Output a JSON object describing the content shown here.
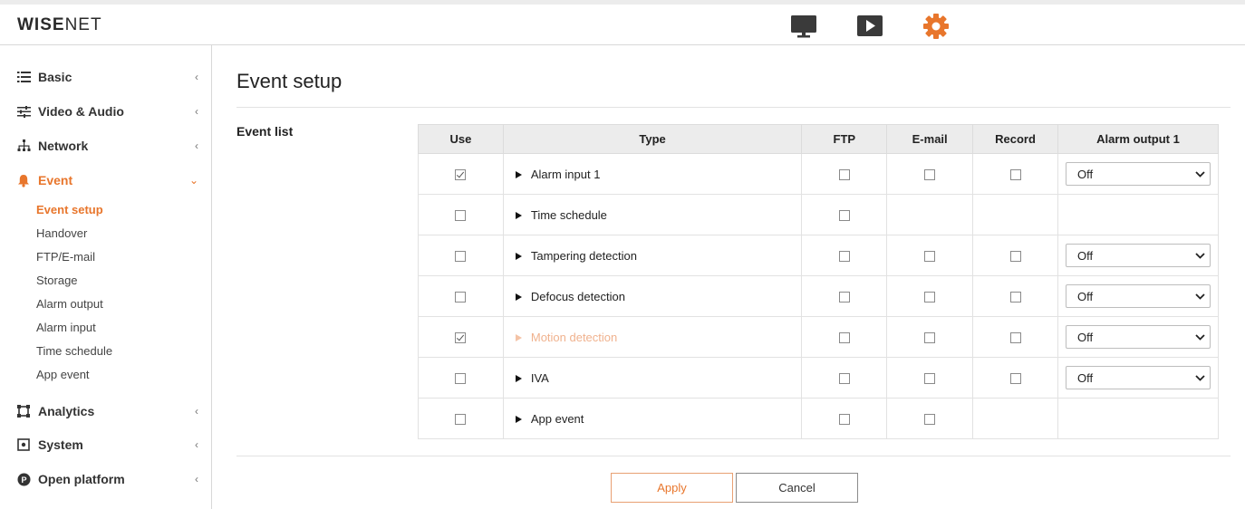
{
  "brand": {
    "logo_bold": "WISE",
    "logo_light": "NET"
  },
  "header": {
    "icons": [
      "monitor-icon",
      "playback-icon",
      "settings-gear-icon"
    ],
    "accent": "#e8762c"
  },
  "sidebar": {
    "basic": "Basic",
    "video_audio": "Video & Audio",
    "network": "Network",
    "event": "Event",
    "event_sub": {
      "event_setup": "Event setup",
      "handover": "Handover",
      "ftp_email": "FTP/E-mail",
      "storage": "Storage",
      "alarm_output": "Alarm output",
      "alarm_input": "Alarm input",
      "time_schedule": "Time schedule",
      "app_event": "App event"
    },
    "analytics": "Analytics",
    "system": "System",
    "open_platform": "Open platform",
    "chevron_closed": "‹",
    "chevron_open": "⌄"
  },
  "main": {
    "title": "Event setup",
    "section_label": "Event list",
    "columns": {
      "use": "Use",
      "type": "Type",
      "ftp": "FTP",
      "email": "E-mail",
      "record": "Record",
      "alarm_output": "Alarm output 1"
    },
    "rows": [
      {
        "type": "Alarm input 1",
        "use": true,
        "ftp": false,
        "email": false,
        "record": false,
        "alarm": "Off"
      },
      {
        "type": "Time schedule",
        "use": false,
        "ftp": false
      },
      {
        "type": "Tampering detection",
        "use": false,
        "ftp": false,
        "email": false,
        "record": false,
        "alarm": "Off"
      },
      {
        "type": "Defocus detection",
        "use": false,
        "ftp": false,
        "email": false,
        "record": false,
        "alarm": "Off"
      },
      {
        "type": "Motion detection",
        "use": true,
        "ftp": false,
        "email": false,
        "record": false,
        "alarm": "Off",
        "highlighted": true
      },
      {
        "type": "IVA",
        "use": false,
        "ftp": false,
        "email": false,
        "record": false,
        "alarm": "Off"
      },
      {
        "type": "App event",
        "use": false,
        "ftp": false,
        "email": false
      }
    ]
  },
  "buttons": {
    "apply": "Apply",
    "cancel": "Cancel"
  }
}
